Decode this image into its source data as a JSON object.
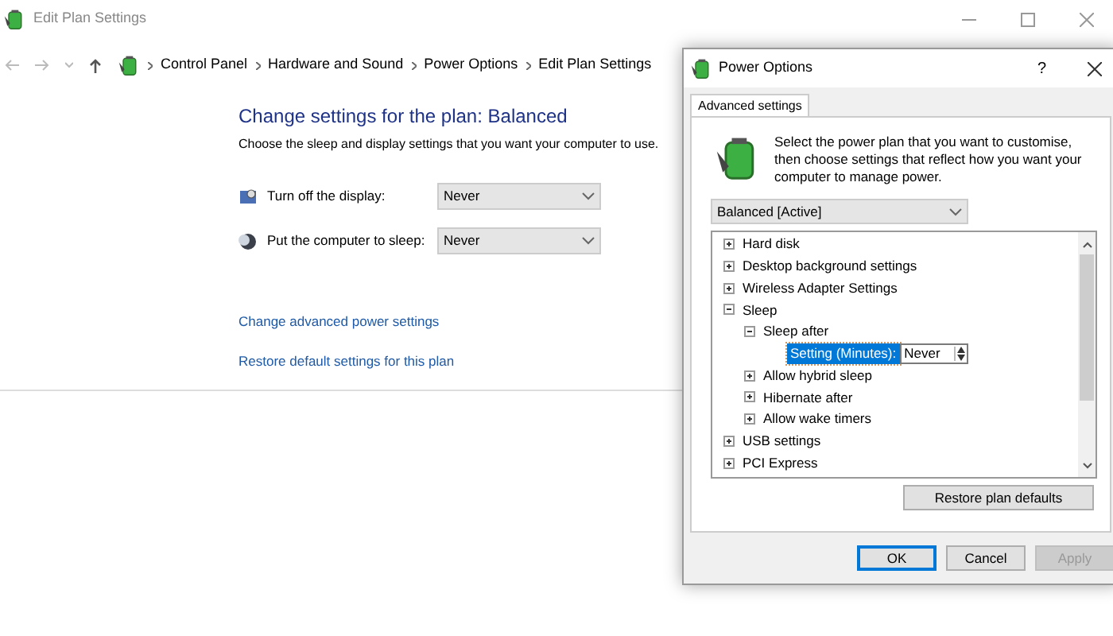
{
  "main_window": {
    "title": "Edit Plan Settings",
    "breadcrumb": [
      "Control Panel",
      "Hardware and Sound",
      "Power Options",
      "Edit Plan Settings"
    ],
    "heading": "Change settings for the plan: Balanced",
    "description": "Choose the sleep and display settings that you want your computer to use.",
    "settings": [
      {
        "kind": "display",
        "label": "Turn off the display:",
        "value": "Never"
      },
      {
        "kind": "sleep",
        "label": "Put the computer to sleep:",
        "value": "Never"
      }
    ],
    "links": [
      "Change advanced power settings",
      "Restore default settings for this plan"
    ]
  },
  "dialog": {
    "title": "Power Options",
    "help": "?",
    "tabs": [
      {
        "label": "Advanced settings",
        "selected": true
      }
    ],
    "intro": "Select the power plan that you want to customise, then choose settings that reflect how you want your computer to manage power.",
    "plan": "Balanced [Active]",
    "tree": [
      {
        "kind": "group",
        "label": "Hard disk",
        "expanded": false
      },
      {
        "kind": "group",
        "label": "Desktop background settings",
        "expanded": false
      },
      {
        "kind": "group",
        "label": "Wireless Adapter Settings",
        "expanded": false
      },
      {
        "kind": "group",
        "label": "Sleep",
        "expanded": true,
        "children": [
          {
            "kind": "group",
            "label": "Sleep after",
            "expanded": true,
            "children": [
              {
                "kind": "setting",
                "label": "Setting (Minutes):",
                "value": "Never",
                "selected": true
              }
            ]
          },
          {
            "kind": "group",
            "label": "Allow hybrid sleep",
            "expanded": false
          },
          {
            "kind": "group",
            "label": "Hibernate after",
            "expanded": false
          },
          {
            "kind": "group",
            "label": "Allow wake timers",
            "expanded": false
          }
        ]
      },
      {
        "kind": "group",
        "label": "USB settings",
        "expanded": false
      },
      {
        "kind": "group",
        "label": "PCI Express",
        "expanded": false
      }
    ],
    "restore_button": "Restore plan defaults",
    "buttons": [
      {
        "label": "OK",
        "default": true,
        "disabled": false
      },
      {
        "label": "Cancel",
        "default": false,
        "disabled": false
      },
      {
        "label": "Apply",
        "default": false,
        "disabled": true
      }
    ]
  }
}
